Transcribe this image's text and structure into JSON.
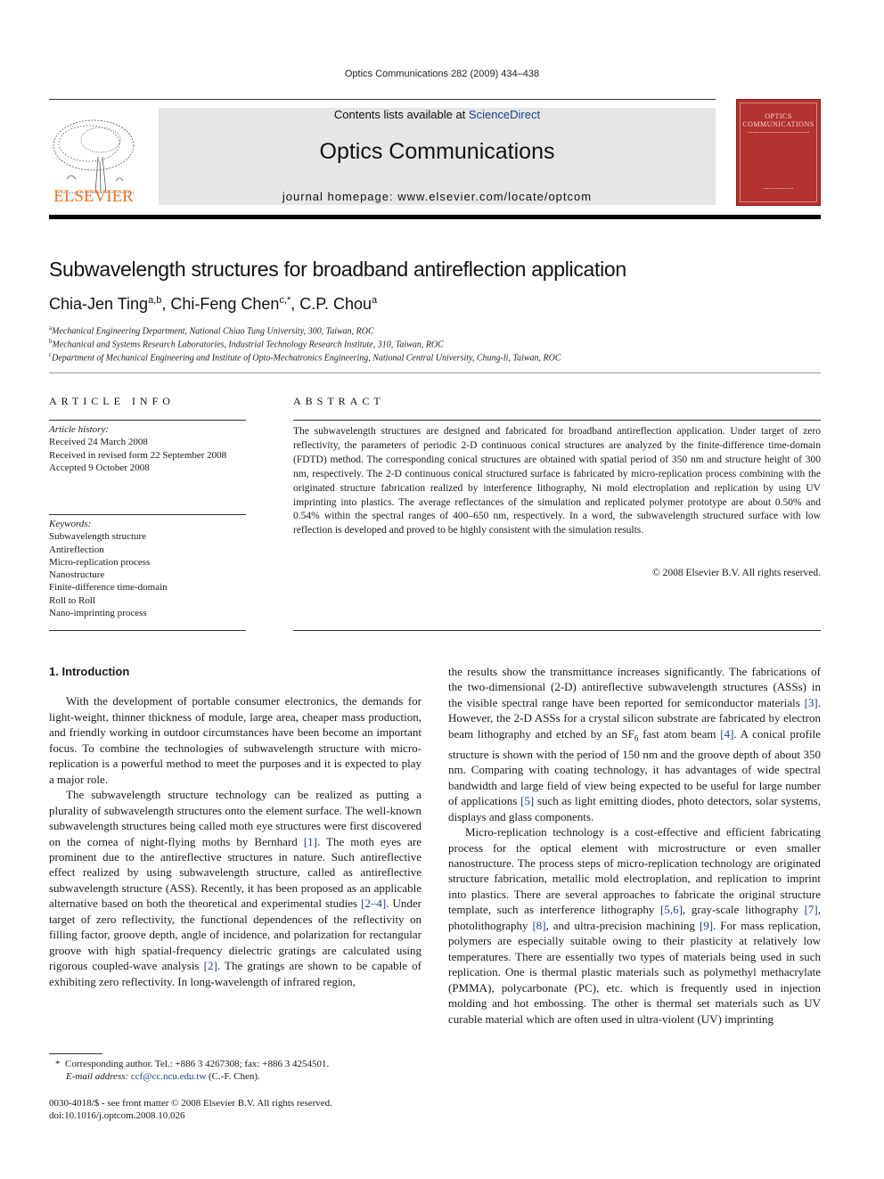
{
  "running_head": "Optics Communications 282 (2009) 434–438",
  "masthead": {
    "publisher_wordmark": "ELSEVIER",
    "contents_prefix": "Contents lists available at ",
    "contents_link": "ScienceDirect",
    "journal_title": "Optics Communications",
    "homepage": "journal homepage: www.elsevier.com/locate/optcom",
    "cover_title_line1": "OPTICS",
    "cover_title_line2": "COMMUNICATIONS",
    "cover_color": "#b3312e",
    "wordmark_color": "#f0711c",
    "link_color": "#1f3f8f"
  },
  "article": {
    "title": "Subwavelength structures for broadband antireflection application",
    "authors": [
      {
        "name": "Chia-Jen Ting",
        "sup": "a,b",
        "sep": ", "
      },
      {
        "name": "Chi-Feng Chen",
        "sup": "c,*",
        "sep": ", "
      },
      {
        "name": "C.P. Chou",
        "sup": "a",
        "sep": ""
      }
    ],
    "affiliations": [
      {
        "mark": "a",
        "text": "Mechanical Engineering Department, National Chiao Tung University, 300, Taiwan, ROC"
      },
      {
        "mark": "b",
        "text": "Mechanical and Systems Research Laboratories, Industrial Technology Research Institute, 310, Taiwan, ROC"
      },
      {
        "mark": "c",
        "text": "Department of Mechanical Engineering and Institute of Opto-Mechatronics Engineering, National Central University, Chung-li, Taiwan, ROC"
      }
    ]
  },
  "article_info": {
    "heading": "ARTICLE INFO",
    "history_label": "Article history:",
    "history": [
      "Received 24 March 2008",
      "Received in revised form 22 September 2008",
      "Accepted 9 October 2008"
    ],
    "keywords_label": "Keywords:",
    "keywords": [
      "Subwavelength structure",
      "Antireflection",
      "Micro-replication process",
      "Nanostructure",
      "Finite-difference time-domain",
      "Roll to Roll",
      "Nano-imprinting process"
    ]
  },
  "abstract": {
    "heading": "ABSTRACT",
    "text": "The subwavelength structures are designed and fabricated for broadband antireflection application. Under target of zero reflectivity, the parameters of periodic 2-D continuous conical structures are analyzed by the finite-difference time-domain (FDTD) method. The corresponding conical structures are obtained with spatial period of 350 nm and structure height of 300 nm, respectively. The 2-D continuous conical structured surface is fabricated by micro-replication process combining with the originated structure fabrication realized by interference lithography, Ni mold electroplation and replication by using UV imprinting into plastics. The average reflectances of the simulation and replicated polymer prototype are about 0.50% and 0.54% within the spectral ranges of 400–650 nm, respectively. In a word, the subwavelength structured surface with low reflection is developed and proved to be highly consistent with the simulation results.",
    "copyright": "© 2008 Elsevier B.V. All rights reserved."
  },
  "body": {
    "section_heading": "1. Introduction",
    "left": {
      "p1": "With the development of portable consumer electronics, the demands for light-weight, thinner thickness of module, large area, cheaper mass production, and friendly working in outdoor circumstances have been become an important focus. To combine the technologies of subwavelength structure with micro-replication is a powerful method to meet the purposes and it is expected to play a major role.",
      "p2a": "The subwavelength structure technology can be realized as putting a plurality of subwavelength structures onto the element surface. The well-known subwavelength structures being called moth eye structures were first discovered on the cornea of night-flying moths by Bernhard ",
      "r1": "[1]",
      "p2b": ". The moth eyes are prominent due to the antireflective structures in nature. Such antireflective effect realized by using subwavelength structure, called as antireflective subwavelength structure (ASS). Recently, it has been proposed as an applicable alternative based on both the theoretical and experimental studies ",
      "r2": "[2–4]",
      "p2c": ". Under target of zero reflectivity, the functional dependences of the reflectivity on filling factor, groove depth, angle of incidence, and polarization for rectangular groove with high spatial-frequency dielectric gratings are calculated using rigorous coupled-wave analysis ",
      "r3": "[2]",
      "p2d": ". The gratings are shown to be capable of exhibiting zero reflectivity. In long-wavelength of infrared region,"
    },
    "right": {
      "p1a": "the results show the transmittance increases significantly. The fabrications of the two-dimensional (2-D) antireflective subwavelength structures (ASSs) in the visible spectral range have been reported for semiconductor materials ",
      "r1": "[3]",
      "p1b": ". However, the 2-D ASSs for a crystal silicon substrate are fabricated by electron beam lithography and etched by an SF",
      "sub": "6",
      "p1c": " fast atom beam ",
      "r2": "[4]",
      "p1d": ". A conical profile structure is shown with the period of 150 nm and the groove depth of about 350 nm. Comparing with coating technology, it has advantages of wide spectral bandwidth and large field of view being expected to be useful for large number of applications ",
      "r3": "[5]",
      "p1e": " such as light emitting diodes, photo detectors, solar systems, displays and glass components.",
      "p2a": "Micro-replication technology is a cost-effective and efficient fabricating process for the optical element with microstructure or even smaller nanostructure. The process steps of micro-replication technology are originated structure fabrication, metallic mold electroplation, and replication to imprint into plastics. There are several approaches to fabricate the original structure template, such as interference lithography ",
      "r4": "[5,6]",
      "p2b": ", gray-scale lithography ",
      "r5": "[7]",
      "p2c": ", photolithography ",
      "r6": "[8]",
      "p2d": ", and ultra-precision machining ",
      "r7": "[9]",
      "p2e": ". For mass replication, polymers are especially suitable owing to their plasticity at relatively low temperatures. There are essentially two types of materials being used in such replication. One is thermal plastic materials such as polymethyl methacrylate (PMMA), polycarbonate (PC), etc. which is frequently used in injection molding and hot embossing. The other is thermal set materials such as UV curable material which are often used in ultra-violent (UV) imprinting"
    }
  },
  "footnotes": {
    "star": "*",
    "corresponding": "Corresponding author. Tel.: +886 3 4267308; fax: +886 3 4254501.",
    "email_label": "E-mail address:",
    "email": "ccf@cc.ncu.edu.tw",
    "email_suffix": " (C.-F. Chen).",
    "issn": "0030-4018/$ - see front matter © 2008 Elsevier B.V. All rights reserved.",
    "doi": "doi:10.1016/j.optcom.2008.10.026"
  }
}
